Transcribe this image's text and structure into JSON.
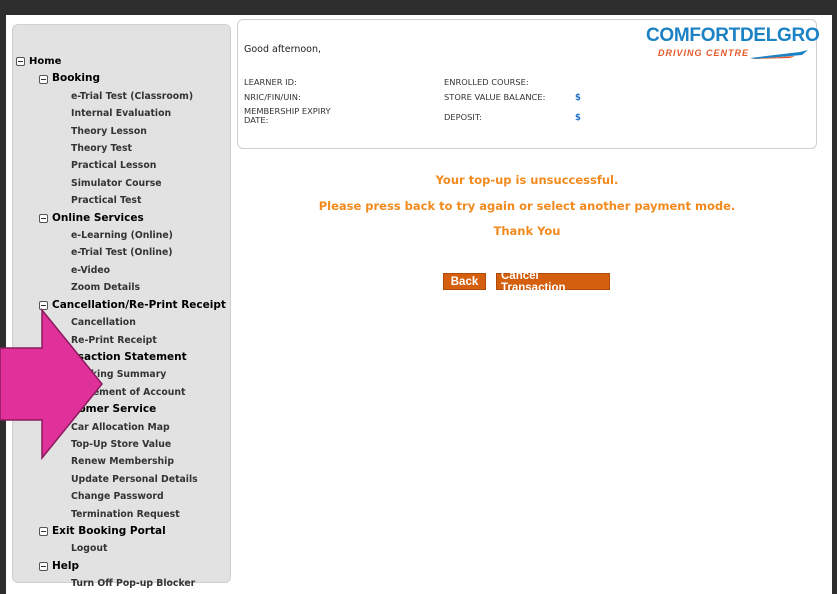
{
  "sidebar": {
    "items": [
      {
        "label": "Home",
        "level": 0,
        "toggle": true
      },
      {
        "label": "Booking",
        "level": 1,
        "toggle": true
      },
      {
        "label": "e-Trial Test (Classroom)",
        "level": 2
      },
      {
        "label": "Internal Evaluation",
        "level": 2
      },
      {
        "label": "Theory Lesson",
        "level": 2
      },
      {
        "label": "Theory Test",
        "level": 2
      },
      {
        "label": "Practical Lesson",
        "level": 2
      },
      {
        "label": "Simulator Course",
        "level": 2
      },
      {
        "label": "Practical Test",
        "level": 2
      },
      {
        "label": "Online Services",
        "level": 1,
        "toggle": true
      },
      {
        "label": "e-Learning (Online)",
        "level": 2
      },
      {
        "label": "e-Trial Test (Online)",
        "level": 2
      },
      {
        "label": "e-Video",
        "level": 2
      },
      {
        "label": "Zoom Details",
        "level": 2
      },
      {
        "label": "Cancellation/Re-Print Receipt",
        "level": 1,
        "toggle": true
      },
      {
        "label": "Cancellation",
        "level": 2
      },
      {
        "label": "Re-Print Receipt",
        "level": 2
      },
      {
        "label": "Transaction Statement",
        "level": 1,
        "toggle": true
      },
      {
        "label": "Booking Summary",
        "level": 2
      },
      {
        "label": "Statement of Account",
        "level": 2
      },
      {
        "label": "Customer Service",
        "level": 1,
        "toggle": true
      },
      {
        "label": "Car Allocation Map",
        "level": 2
      },
      {
        "label": "Top-Up Store Value",
        "level": 2
      },
      {
        "label": "Renew Membership",
        "level": 2
      },
      {
        "label": "Update Personal Details",
        "level": 2
      },
      {
        "label": "Change Password",
        "level": 2
      },
      {
        "label": "Termination Request",
        "level": 2
      },
      {
        "label": "Exit Booking Portal",
        "level": 1,
        "toggle": true
      },
      {
        "label": "Logout",
        "level": 2
      },
      {
        "label": "Help",
        "level": 1,
        "toggle": true
      },
      {
        "label": "Turn Off Pop-up Blocker",
        "level": 2
      }
    ]
  },
  "header": {
    "greeting": "Good afternoon,",
    "logo_main": "COMFORTDELGRO",
    "logo_sub": "DRIVING CENTRE",
    "learner_id_label": "LEARNER ID:",
    "nric_label": "NRIC/FIN/UIN:",
    "membership_label_1": "MEMBERSHIP EXPIRY",
    "membership_label_2": "DATE:",
    "enrolled_course_label": "ENROLLED COURSE:",
    "store_value_label": "STORE VALUE BALANCE:",
    "store_value_currency": "$",
    "deposit_label": "DEPOSIT:",
    "deposit_currency": "$"
  },
  "message": {
    "line1": "Your top-up is unsuccessful.",
    "line2": "Please press back to try again or select another payment mode.",
    "line3": "Thank You"
  },
  "buttons": {
    "back": "Back",
    "cancel": "Cancel Transaction"
  },
  "colors": {
    "accent_orange": "#f28a1e",
    "button_orange": "#d45f0e",
    "logo_blue": "#1b82c5",
    "overlay_arrow": "#e0309a"
  }
}
